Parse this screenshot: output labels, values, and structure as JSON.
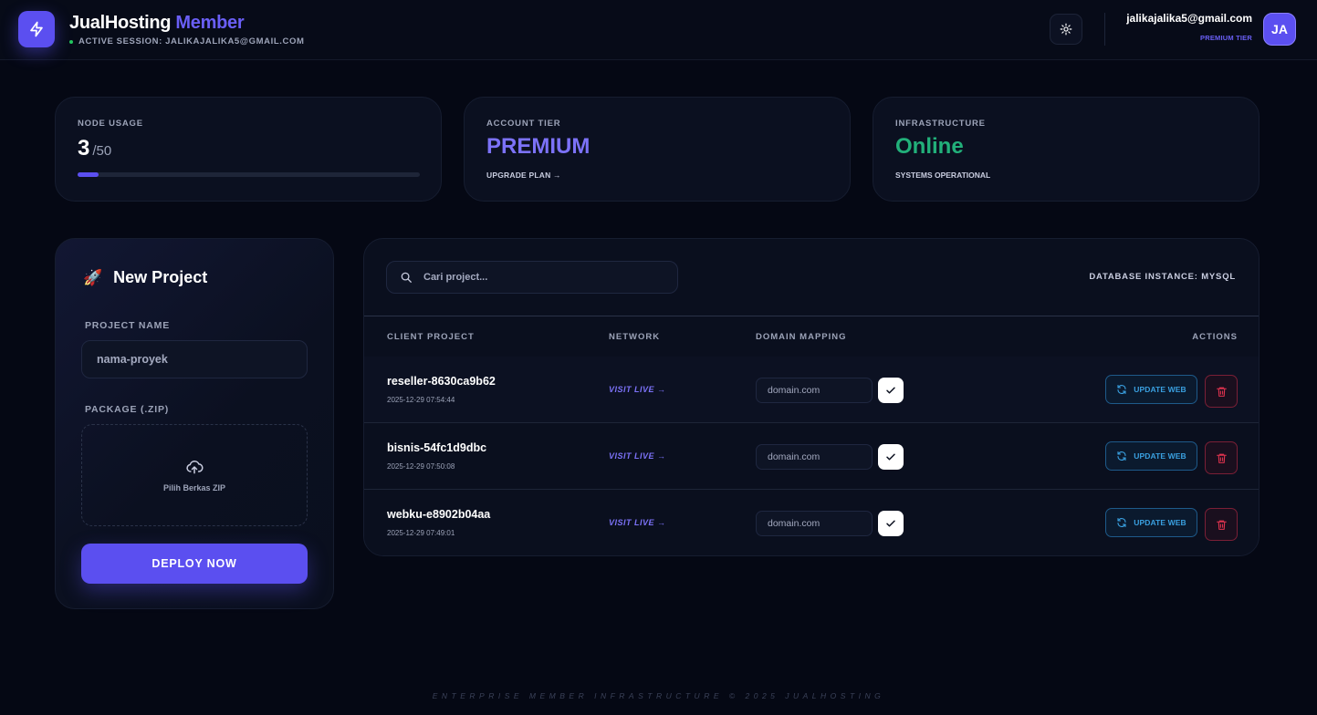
{
  "header": {
    "brand_primary": "JualHosting",
    "brand_secondary": "Member",
    "session_label": "ACTIVE SESSION: JALIKAJALIKA5@GMAIL.COM",
    "user_email": "jalikajalika5@gmail.com",
    "user_tier": "PREMIUM TIER",
    "avatar_initials": "JA",
    "logo_icon": "lightning-icon",
    "theme_icon": "sun-icon"
  },
  "stats": {
    "node_usage": {
      "label": "NODE USAGE",
      "value": "3",
      "max": "/50",
      "progress": 0.06
    },
    "account_tier": {
      "label": "ACCOUNT TIER",
      "value": "PREMIUM",
      "link": "UPGRADE PLAN →"
    },
    "infrastructure": {
      "label": "INFRASTRUCTURE",
      "value": "Online",
      "status": "SYSTEMS OPERATIONAL"
    }
  },
  "new_project": {
    "title": "New Project",
    "icon": "rocket-icon",
    "name_label": "PROJECT NAME",
    "name_value": "nama-proyek",
    "package_label": "PACKAGE (.ZIP)",
    "dropzone_text": "Pilih Berkas ZIP",
    "deploy_label": "DEPLOY NOW"
  },
  "projects_table": {
    "search_placeholder": "Cari project...",
    "db_instance": "DATABASE INSTANCE: MYSQL",
    "columns": [
      "CLIENT PROJECT",
      "NETWORK",
      "DOMAIN MAPPING",
      "ACTIONS"
    ],
    "rows": [
      {
        "name": "reseller-8630ca9b62",
        "date": "2025-12-29 07:54:44",
        "network": "VISIT LIVE →",
        "domain_placeholder": "domain.com",
        "update_label": "UPDATE WEB"
      },
      {
        "name": "bisnis-54fc1d9dbc",
        "date": "2025-12-29 07:50:08",
        "network": "VISIT LIVE →",
        "domain_placeholder": "domain.com",
        "update_label": "UPDATE WEB"
      },
      {
        "name": "webku-e8902b04aa",
        "date": "2025-12-29 07:49:01",
        "network": "VISIT LIVE →",
        "domain_placeholder": "domain.com",
        "update_label": "UPDATE WEB"
      }
    ]
  },
  "footer": {
    "text": "ENTERPRISE MEMBER INFRASTRUCTURE © 2025 JUALHOSTING"
  },
  "colors": {
    "accent": "#5b4ff0",
    "online": "#22b07a",
    "update": "#3aa0e0",
    "danger": "#e0334f",
    "background": "#050814"
  }
}
